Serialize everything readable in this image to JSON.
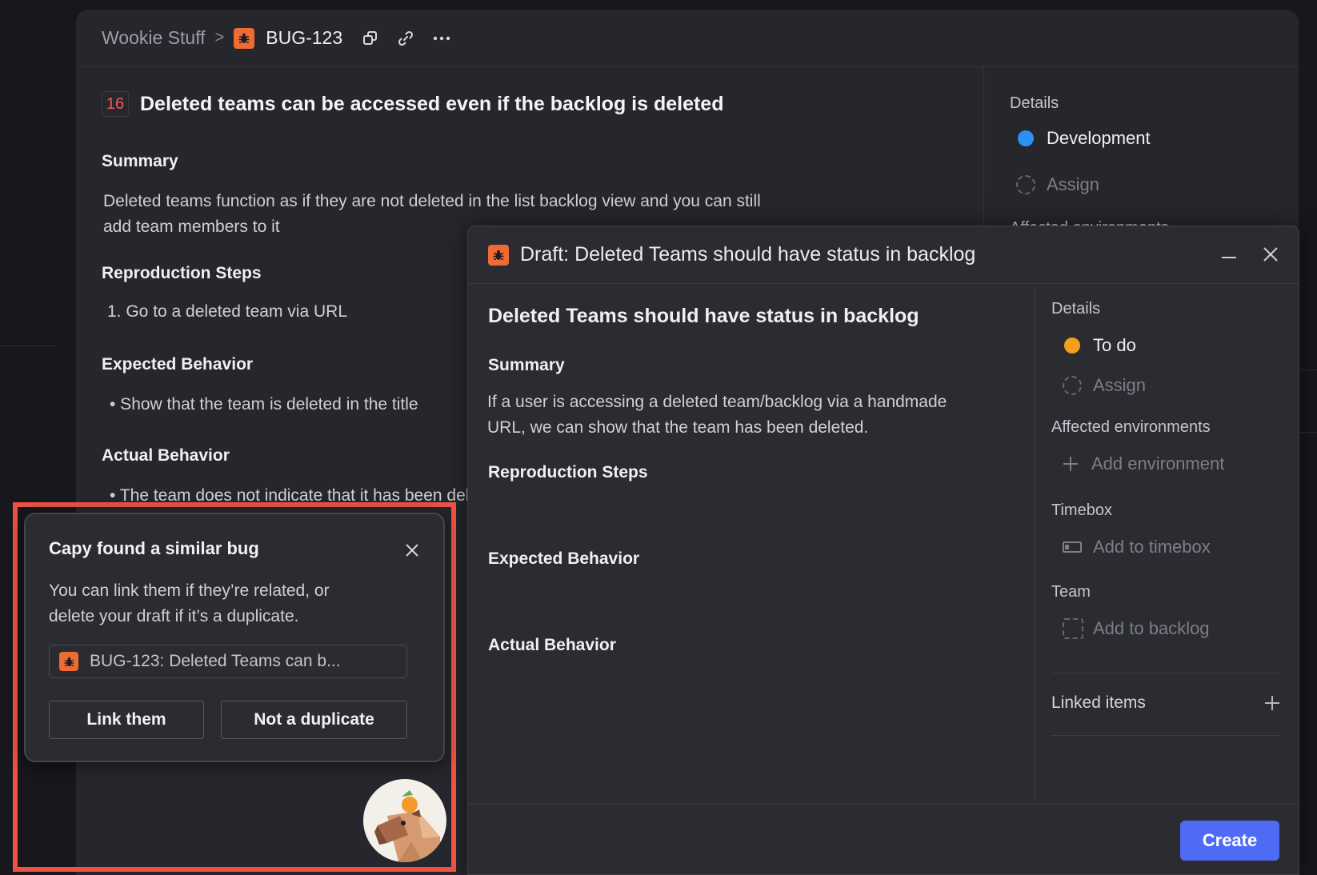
{
  "colors": {
    "bug_orange": "#f06a34",
    "issue_number_red": "#f05a4f",
    "status_development": "#2e8ff5",
    "status_todo": "#f4a01c",
    "primary_blue": "#4e6bf5",
    "highlight_red": "#ef5245"
  },
  "breadcrumb": {
    "project": "Wookie Stuff",
    "separator": ">",
    "issue_id": "BUG-123"
  },
  "issue": {
    "number": "16",
    "title": "Deleted teams can be accessed even if the backlog is deleted",
    "summary_heading": "Summary",
    "summary_line1": "Deleted teams function as if they are not deleted in the list backlog view and you can still",
    "summary_line2": "add team members to it",
    "repro_heading": "Reproduction Steps",
    "repro_step": "1. Go to a deleted team via URL",
    "expected_heading": "Expected Behavior",
    "expected_item": "• Show that the team is deleted in the title",
    "actual_heading": "Actual Behavior",
    "actual_item": "• The team does not indicate that it has been deleted"
  },
  "issue_details": {
    "heading": "Details",
    "status": "Development",
    "assign": "Assign",
    "affected_environments": "Affected environments"
  },
  "draft": {
    "header_title": "Draft: Deleted Teams should have status in backlog",
    "title": "Deleted Teams should have status in backlog",
    "summary_heading": "Summary",
    "summary_line1": "If a user is accessing a deleted team/backlog via a handmade",
    "summary_line2": "URL, we can show that the team has been deleted.",
    "repro_heading": "Reproduction Steps",
    "expected_heading": "Expected Behavior",
    "actual_heading": "Actual Behavior",
    "details": {
      "heading": "Details",
      "status": "To do",
      "assign": "Assign",
      "env_heading": "Affected environments",
      "env_add": "Add environment",
      "timebox_heading": "Timebox",
      "timebox_add": "Add to timebox",
      "team_heading": "Team",
      "team_add": "Add to backlog",
      "linked_items": "Linked items"
    },
    "create_label": "Create"
  },
  "popup": {
    "title": "Capy found a similar bug",
    "text_line1": "You can link them if they’re related, or",
    "text_line2": "delete your draft if it’s a duplicate.",
    "linked_issue": "BUG-123: Deleted Teams can b...",
    "link_button": "Link them",
    "not_duplicate_button": "Not a duplicate"
  }
}
